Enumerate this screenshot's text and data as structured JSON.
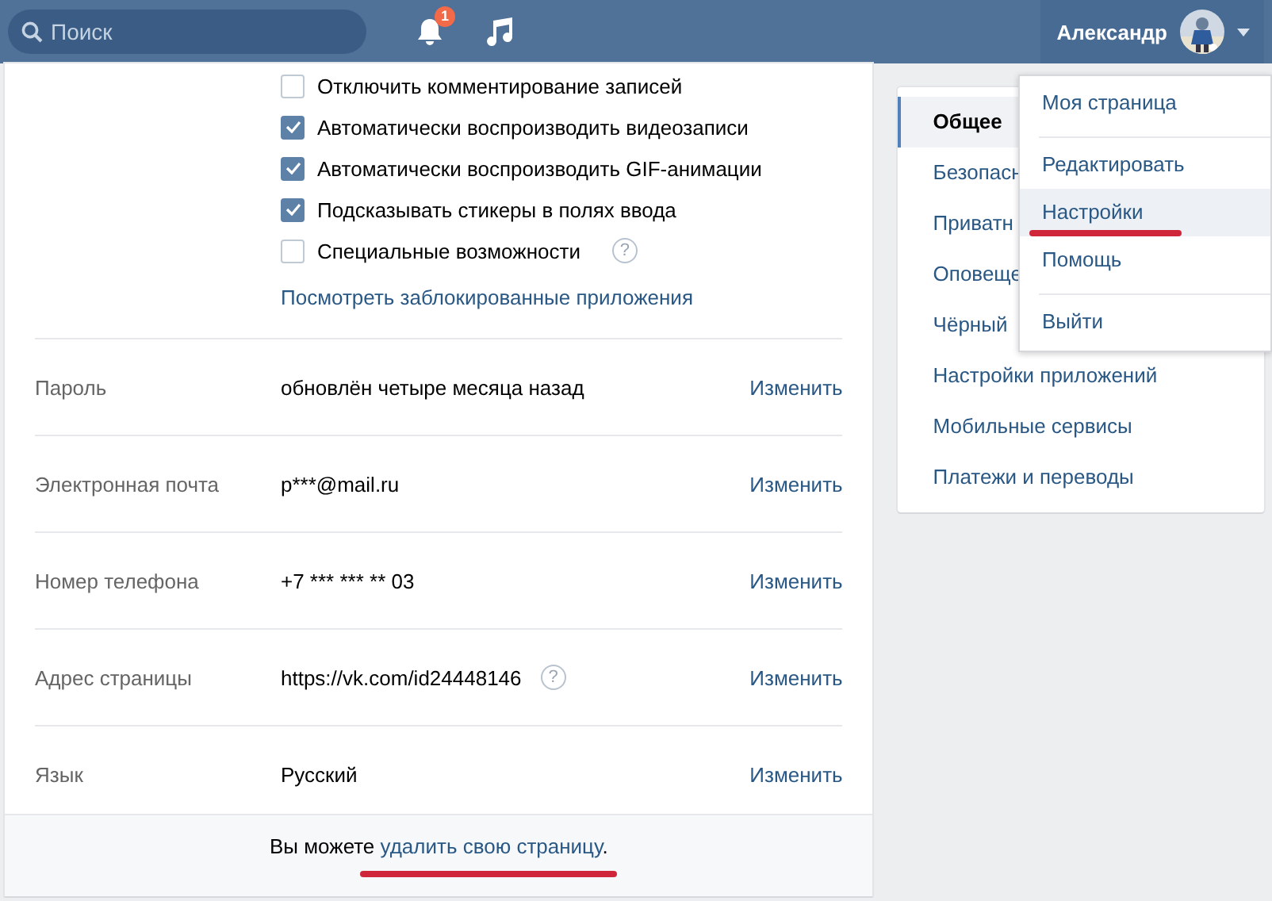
{
  "topbar": {
    "search": {
      "placeholder": "Поиск"
    },
    "notifications_badge": "1",
    "user_name": "Александр"
  },
  "options": [
    {
      "label": "Отключить комментирование записей",
      "checked": false
    },
    {
      "label": "Автоматически воспроизводить видеозаписи",
      "checked": true
    },
    {
      "label": "Автоматически воспроизводить GIF-анимации",
      "checked": true
    },
    {
      "label": "Подсказывать стикеры в полях ввода",
      "checked": true
    },
    {
      "label": "Специальные возможности",
      "checked": false,
      "hint": "?"
    }
  ],
  "blocked_apps_link": "Посмотреть заблокированные приложения",
  "fields": [
    {
      "label": "Пароль",
      "value": "обновлён четыре месяца назад",
      "action": "Изменить"
    },
    {
      "label": "Электронная почта",
      "value": "p***@mail.ru",
      "action": "Изменить"
    },
    {
      "label": "Номер телефона",
      "value": "+7 *** *** ** 03",
      "action": "Изменить"
    },
    {
      "label": "Адрес страницы",
      "value": "https://vk.com/id24448146",
      "action": "Изменить",
      "hint": "?"
    },
    {
      "label": "Язык",
      "value": "Русский",
      "action": "Изменить"
    }
  ],
  "footer": {
    "text": "Вы можете",
    "link": "удалить свою страницу",
    "after": ".",
    "link_underlined": true
  },
  "sidebar": {
    "items": [
      {
        "label": "Общее",
        "selected": true
      },
      {
        "label": "Безопасн",
        "selected": false
      },
      {
        "label": "Приватн",
        "selected": false
      },
      {
        "label": "Оповеще",
        "selected": false
      },
      {
        "label": "Чёрный",
        "selected": false
      },
      {
        "label": "Настройки приложений",
        "selected": false
      },
      {
        "label": "Мобильные сервисы",
        "selected": false
      },
      {
        "label": "Платежи и переводы",
        "selected": false
      }
    ]
  },
  "dropdown": {
    "items": [
      {
        "label": "Моя страница",
        "selected": false,
        "underlined": false,
        "divider_after": true
      },
      {
        "label": "Редактировать",
        "selected": false,
        "underlined": false,
        "divider_after": false
      },
      {
        "label": "Настройки",
        "selected": true,
        "underlined": true,
        "divider_after": false
      },
      {
        "label": "Помощь",
        "selected": false,
        "underlined": false,
        "divider_after": true
      },
      {
        "label": "Выйти",
        "selected": false,
        "underlined": false,
        "divider_after": false
      }
    ]
  }
}
